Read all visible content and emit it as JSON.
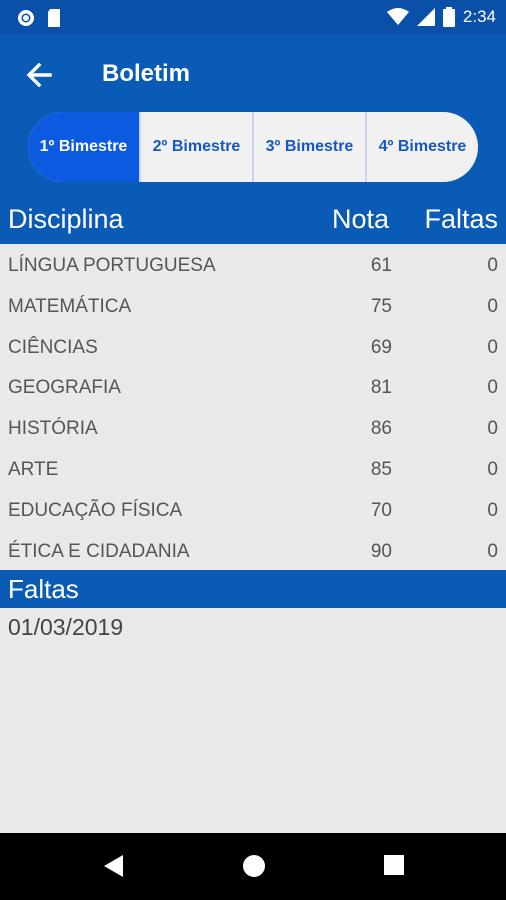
{
  "status": {
    "time": "2:34"
  },
  "appbar": {
    "title": "Boletim"
  },
  "tabs": [
    {
      "label": "1º Bimestre",
      "active": true
    },
    {
      "label": "2º Bimestre"
    },
    {
      "label": "3º Bimestre"
    },
    {
      "label": "4º Bimestre"
    }
  ],
  "table": {
    "headers": {
      "discipline": "Disciplina",
      "grade": "Nota",
      "absences": "Faltas"
    },
    "rows": [
      {
        "name": "LÍNGUA PORTUGUESA",
        "grade": "61",
        "absences": "0"
      },
      {
        "name": "MATEMÁTICA",
        "grade": "75",
        "absences": "0"
      },
      {
        "name": "CIÊNCIAS",
        "grade": "69",
        "absences": "0"
      },
      {
        "name": "GEOGRAFIA",
        "grade": "81",
        "absences": "0"
      },
      {
        "name": "HISTÓRIA",
        "grade": "86",
        "absences": "0"
      },
      {
        "name": "ARTE",
        "grade": "85",
        "absences": "0"
      },
      {
        "name": "EDUCAÇÃO FÍSICA",
        "grade": "70",
        "absences": "0"
      },
      {
        "name": "ÉTICA E CIDADANIA",
        "grade": "90",
        "absences": "0"
      }
    ]
  },
  "absences_section": {
    "title": "Faltas",
    "dates": [
      "01/03/2019"
    ]
  },
  "icons": {
    "status_left": [
      "circle-notification-icon",
      "sd-card-icon"
    ],
    "status_right": [
      "wifi-icon",
      "signal-icon",
      "battery-icon"
    ],
    "nav": [
      "back-triangle-icon",
      "home-circle-icon",
      "recents-square-icon"
    ],
    "appbar_back": "arrow-left-icon"
  },
  "colors": {
    "primary": "#0a5bb5",
    "tab_active": "#0c5ae0",
    "tab_text": "#1757c4",
    "background": "#e9e9e9"
  }
}
